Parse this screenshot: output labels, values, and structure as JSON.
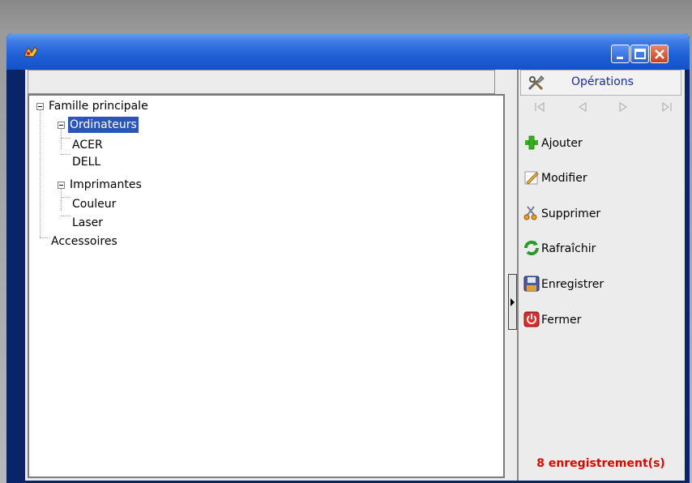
{
  "tree": {
    "root": "Famille principale",
    "nodes": [
      {
        "label": "Ordinateurs",
        "selected": true
      },
      {
        "label": "ACER"
      },
      {
        "label": "DELL"
      },
      {
        "label": "Imprimantes"
      },
      {
        "label": "Couleur"
      },
      {
        "label": "Laser"
      },
      {
        "label": "Accessoires"
      }
    ]
  },
  "operations": {
    "title": "Opérations",
    "nav_icons": [
      "first-icon",
      "previous-icon",
      "next-icon",
      "last-icon"
    ],
    "actions": [
      {
        "label": "Ajouter",
        "icon": "plus-icon"
      },
      {
        "label": "Modifier",
        "icon": "pencil-icon"
      },
      {
        "label": "Supprimer",
        "icon": "scissors-icon"
      },
      {
        "label": "Rafraîchir",
        "icon": "refresh-icon"
      },
      {
        "label": "Enregistrer",
        "icon": "save-icon"
      },
      {
        "label": "Fermer",
        "icon": "power-icon"
      }
    ],
    "record_count": "8 enregistrement(s)"
  },
  "colors": {
    "titlebar": "#1e5ed6",
    "selection": "#2b56b8",
    "record_count": "#e00000",
    "ops_title": "#1c2a9e"
  }
}
